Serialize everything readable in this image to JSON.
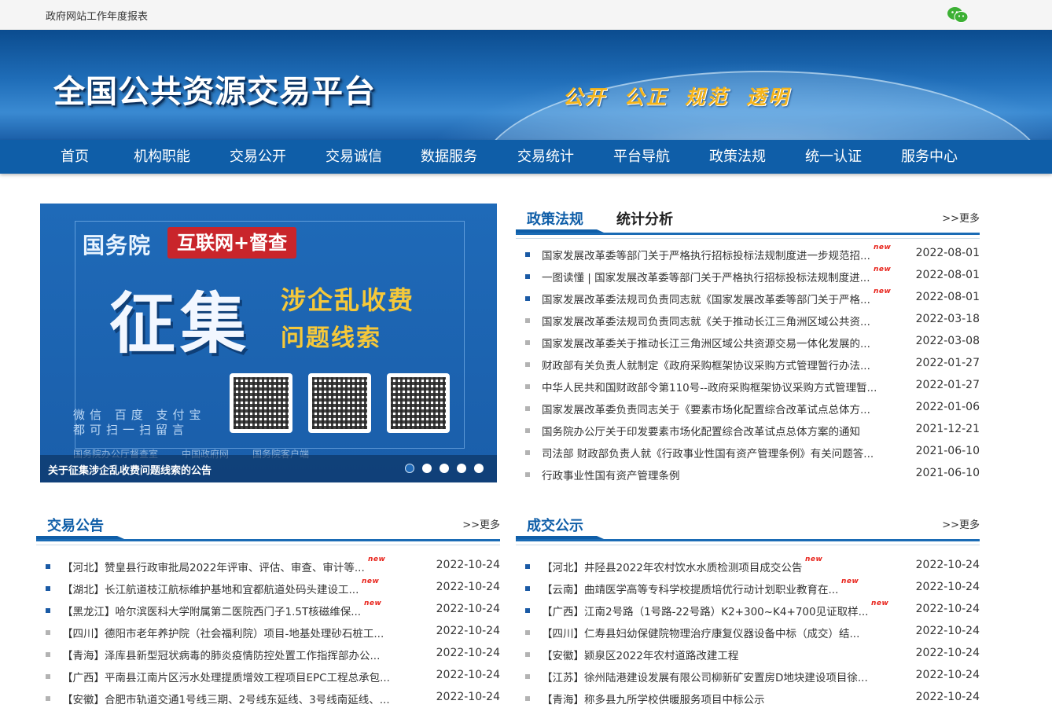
{
  "topbar": {
    "report_link": "政府网站工作年度报表",
    "wechat_icon": "wechat-icon"
  },
  "banner": {
    "title": "全国公共资源交易平台",
    "slogan": "公开 公正 规范 透明"
  },
  "nav": [
    "首页",
    "机构职能",
    "交易公开",
    "交易诚信",
    "数据服务",
    "交易统计",
    "平台导航",
    "政策法规",
    "统一认证",
    "服务中心"
  ],
  "slider": {
    "gwy": "国务院",
    "tag": "互联网+督查",
    "big": "征集",
    "sub1": "涉企乱收费",
    "sub2": "问题线索",
    "scan1": "微信 百度 支付宝",
    "scan2": "都可扫一扫留言",
    "logos": [
      "国务院办公厅督查室",
      "中国政府网",
      "国务院客户端"
    ],
    "caption": "关于征集涉企乱收费问题线索的公告",
    "dots": 5,
    "active_dot": 0
  },
  "policy": {
    "tabs": [
      "政策法规",
      "统计分析"
    ],
    "more": ">>更多",
    "new_label": "new",
    "items": [
      {
        "title": "国家发展改革委等部门关于严格执行招标投标法规制度进一步规范招...",
        "date": "2022-08-01",
        "new": true
      },
      {
        "title": "一图读懂 | 国家发展改革委等部门关于严格执行招标投标法规制度进...",
        "date": "2022-08-01",
        "new": true
      },
      {
        "title": "国家发展改革委法规司负责同志就《国家发展改革委等部门关于严格...",
        "date": "2022-08-01",
        "new": true
      },
      {
        "title": "国家发展改革委法规司负责同志就《关于推动长江三角洲区域公共资...",
        "date": "2022-03-18",
        "new": false
      },
      {
        "title": "国家发展改革委关于推动长江三角洲区域公共资源交易一体化发展的...",
        "date": "2022-03-08",
        "new": false
      },
      {
        "title": "财政部有关负责人就制定《政府采购框架协议采购方式管理暂行办法...",
        "date": "2022-01-27",
        "new": false
      },
      {
        "title": "中华人民共和国财政部令第110号--政府采购框架协议采购方式管理暂...",
        "date": "2022-01-27",
        "new": false
      },
      {
        "title": "国家发展改革委负责同志关于《要素市场化配置综合改革试点总体方...",
        "date": "2022-01-06",
        "new": false
      },
      {
        "title": "国务院办公厅关于印发要素市场化配置综合改革试点总体方案的通知",
        "date": "2021-12-21",
        "new": false
      },
      {
        "title": "司法部 财政部负责人就《行政事业性国有资产管理条例》有关问题答...",
        "date": "2021-06-10",
        "new": false
      },
      {
        "title": "行政事业性国有资产管理条例",
        "date": "2021-06-10",
        "new": false
      }
    ]
  },
  "notice": {
    "heading": "交易公告",
    "more": ">>更多",
    "items": [
      {
        "title": "【河北】赞皇县行政审批局2022年评审、评估、审查、审计等...",
        "date": "2022-10-24",
        "new": true
      },
      {
        "title": "【湖北】长江航道枝江航标维护基地和宜都航道处码头建设工...",
        "date": "2022-10-24",
        "new": true
      },
      {
        "title": "【黑龙江】哈尔滨医科大学附属第二医院西门子1.5T核磁维保...",
        "date": "2022-10-24",
        "new": true
      },
      {
        "title": "【四川】德阳市老年养护院（社会福利院）项目-地基处理砂石桩工...",
        "date": "2022-10-24",
        "new": false
      },
      {
        "title": "【青海】泽库县新型冠状病毒的肺炎疫情防控处置工作指挥部办公...",
        "date": "2022-10-24",
        "new": false
      },
      {
        "title": "【广西】平南县江南片区污水处理提质增效工程项目EPC工程总承包...",
        "date": "2022-10-24",
        "new": false
      },
      {
        "title": "【安徽】合肥市轨道交通1号线三期、2号线东延线、3号线南延线、...",
        "date": "2022-10-24",
        "new": false
      }
    ]
  },
  "deal": {
    "heading": "成交公示",
    "more": ">>更多",
    "items": [
      {
        "title": "【河北】井陉县2022年农村饮水水质检测项目成交公告",
        "date": "2022-10-24",
        "new": true
      },
      {
        "title": "【云南】曲靖医学高等专科学校提质培优行动计划职业教育在...",
        "date": "2022-10-24",
        "new": true
      },
      {
        "title": "【广西】江南2号路（1号路-22号路）K2+300~K4+700见证取样...",
        "date": "2022-10-24",
        "new": true
      },
      {
        "title": "【四川】仁寿县妇幼保健院物理治疗康复仪器设备中标（成交）结...",
        "date": "2022-10-24",
        "new": false
      },
      {
        "title": "【安徽】颍泉区2022年农村道路改建工程",
        "date": "2022-10-24",
        "new": false
      },
      {
        "title": "【江苏】徐州陆港建设发展有限公司柳新矿安置房D地块建设项目徐...",
        "date": "2022-10-24",
        "new": false
      },
      {
        "title": "【青海】称多县九所学校供暖服务项目中标公示",
        "date": "2022-10-24",
        "new": false
      }
    ]
  }
}
